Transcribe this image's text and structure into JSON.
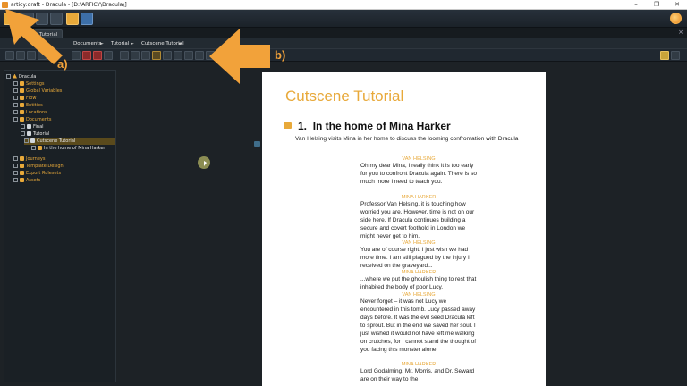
{
  "window": {
    "title": "articy:draft - Dracula - [D:\\ARTICY\\Dracula\\]",
    "minimize": "–",
    "maximize": "❐",
    "close": "✕"
  },
  "tabs": [
    {
      "label": "Tutorial"
    }
  ],
  "tab_close": "×",
  "breadcrumb": {
    "items": [
      "Documents",
      "Tutorial",
      "Cutscene Tutorial"
    ],
    "separator": "►"
  },
  "annotations": {
    "label_a": "a)",
    "label_b": "b)",
    "color": "#f2a23a"
  },
  "tree": {
    "items": [
      {
        "label": "Dracula",
        "icon": "project-icon",
        "color": "white"
      },
      {
        "label": "Settings",
        "icon": "settings-icon",
        "color": "orange"
      },
      {
        "label": "Global Variables",
        "icon": "variables-icon",
        "color": "orange"
      },
      {
        "label": "Flow",
        "icon": "flow-icon",
        "color": "orange"
      },
      {
        "label": "Entities",
        "icon": "entities-icon",
        "color": "orange"
      },
      {
        "label": "Locations",
        "icon": "locations-icon",
        "color": "orange"
      },
      {
        "label": "Documents",
        "icon": "documents-icon",
        "color": "orange"
      },
      {
        "label": "Final",
        "icon": "document-icon",
        "color": "white"
      },
      {
        "label": "Tutorial",
        "icon": "document-icon",
        "color": "white"
      },
      {
        "label": "Cutscene Tutorial",
        "icon": "document-icon",
        "color": "white",
        "selected": true
      },
      {
        "label": "In the home of Mina Harker",
        "icon": "section-icon",
        "color": "white"
      },
      {
        "label": "Journeys",
        "icon": "journeys-icon",
        "color": "orange"
      },
      {
        "label": "Template Design",
        "icon": "template-icon",
        "color": "orange"
      },
      {
        "label": "Export Rulesets",
        "icon": "export-icon",
        "color": "orange"
      },
      {
        "label": "Assets",
        "icon": "assets-icon",
        "color": "orange"
      }
    ]
  },
  "document": {
    "title": "Cutscene Tutorial",
    "section_number": "1.",
    "section_title": "In the home of Mina Harker",
    "section_description": "Van Helsing visits Mina in her home to discuss the looming confrontation with Dracula",
    "dialogue": [
      {
        "speaker": "VAN HELSING",
        "text": "Oh my dear Mina, I really think it is too early for you to confront Dracula again. There is so much more I need to teach you."
      },
      {
        "speaker": "MINA HARKER",
        "text": "Professor Van Helsing, it is touching how worried you are. However, time is not on our side here. If Dracula continues building a secure and covert foothold in London we might never get to him."
      },
      {
        "speaker": "VAN HELSING",
        "text": "You are of course right. I just wish we had more time. I am still plagued by the injury I received on the graveyard..."
      },
      {
        "speaker": "MINA HARKER",
        "text": "...where we put the ghoulish thing to rest that inhabited the body of poor Lucy."
      },
      {
        "speaker": "VAN HELSING",
        "text": "Never forget – it was not Lucy we encountered in this tomb. Lucy passed away days before. It was the evil seed Dracula left to sprout. But in the end we saved her soul. I just wished it would not have left me walking on crutches, for I cannot stand the thought of you facing this monster alone."
      },
      {
        "speaker": "MINA HARKER",
        "text": "Lord Godalming, Mr. Morris, and Dr. Seward are on their way to the"
      }
    ]
  },
  "colors": {
    "accent": "#e8a93a",
    "background": "#1d2226",
    "page": "#ffffff"
  }
}
